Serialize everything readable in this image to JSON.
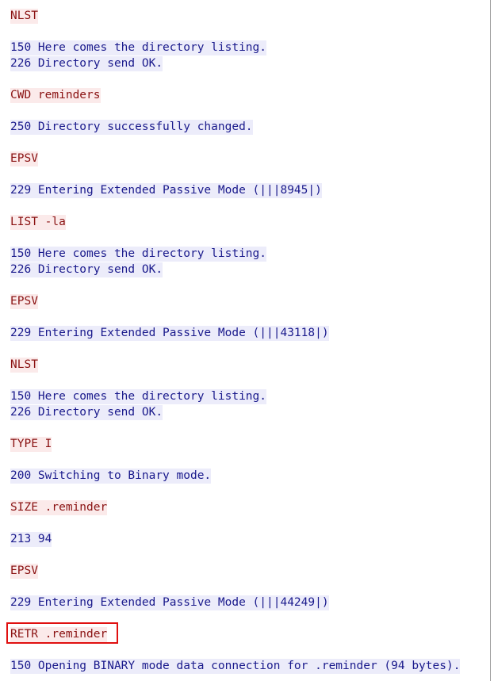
{
  "ftp_stream": {
    "entries": [
      {
        "dir": "client",
        "lines": [
          "NLST"
        ]
      },
      {
        "dir": "server",
        "lines": [
          "150 Here comes the directory listing.",
          "226 Directory send OK."
        ]
      },
      {
        "dir": "client",
        "lines": [
          "CWD reminders"
        ]
      },
      {
        "dir": "server",
        "lines": [
          "250 Directory successfully changed."
        ]
      },
      {
        "dir": "client",
        "lines": [
          "EPSV"
        ]
      },
      {
        "dir": "server",
        "lines": [
          "229 Entering Extended Passive Mode (|||8945|)"
        ]
      },
      {
        "dir": "client",
        "lines": [
          "LIST -la"
        ]
      },
      {
        "dir": "server",
        "lines": [
          "150 Here comes the directory listing.",
          "226 Directory send OK."
        ]
      },
      {
        "dir": "client",
        "lines": [
          "EPSV"
        ]
      },
      {
        "dir": "server",
        "lines": [
          "229 Entering Extended Passive Mode (|||43118|)"
        ]
      },
      {
        "dir": "client",
        "lines": [
          "NLST"
        ]
      },
      {
        "dir": "server",
        "lines": [
          "150 Here comes the directory listing.",
          "226 Directory send OK."
        ]
      },
      {
        "dir": "client",
        "lines": [
          "TYPE I"
        ]
      },
      {
        "dir": "server",
        "lines": [
          "200 Switching to Binary mode."
        ]
      },
      {
        "dir": "client",
        "lines": [
          "SIZE .reminder"
        ]
      },
      {
        "dir": "server",
        "lines": [
          "213 94"
        ]
      },
      {
        "dir": "client",
        "lines": [
          "EPSV"
        ]
      },
      {
        "dir": "server",
        "lines": [
          "229 Entering Extended Passive Mode (|||44249|)"
        ]
      },
      {
        "dir": "client",
        "lines": [
          "RETR .reminder"
        ]
      },
      {
        "dir": "server",
        "lines": [
          "150 Opening BINARY mode data connection for .reminder (94 bytes)."
        ]
      }
    ]
  },
  "colors": {
    "client_text": "#8a1212",
    "client_bg": "#fbeaea",
    "server_text": "#1a1a8c",
    "server_bg": "#ececfa",
    "highlight_border": "#e01010"
  }
}
